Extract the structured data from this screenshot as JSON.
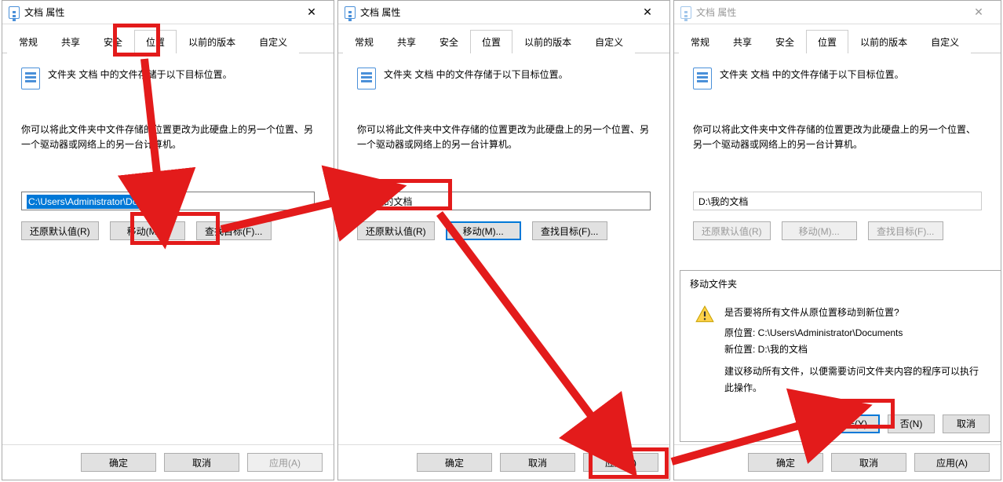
{
  "colors": {
    "highlight_red": "#e31b1b",
    "win_select": "#0078d7"
  },
  "common": {
    "dialog_title": "文档 属性",
    "close_glyph": "✕",
    "tabs": {
      "general": "常规",
      "share": "共享",
      "security": "安全",
      "location": "位置",
      "prev": "以前的版本",
      "custom": "自定义"
    },
    "desc1": "文件夹 文档 中的文件存储于以下目标位置。",
    "desc2": "你可以将此文件夹中文件存储的位置更改为此硬盘上的另一个位置、另一个驱动器或网络上的另一台计算机。",
    "restore_btn": "还原默认值(R)",
    "move_btn": "移动(M)...",
    "find_btn": "查找目标(F)...",
    "ok_btn": "确定",
    "cancel_btn": "取消",
    "apply_btn": "应用(A)"
  },
  "dlg1": {
    "path": "C:\\Users\\Administrator\\Documents"
  },
  "dlg2": {
    "path": "D:\\我的文档"
  },
  "dlg3": {
    "path": "D:\\我的文档"
  },
  "move": {
    "title": "移动文件夹",
    "question": "是否要将所有文件从原位置移动到新位置?",
    "orig_label": "原位置: C:\\Users\\Administrator\\Documents",
    "new_label": "新位置: D:\\我的文档",
    "advice": "建议移动所有文件，以便需要访问文件夹内容的程序可以执行此操作。",
    "yes_btn": "是(Y)",
    "no_btn": "否(N)",
    "cancel_btn": "取消"
  }
}
